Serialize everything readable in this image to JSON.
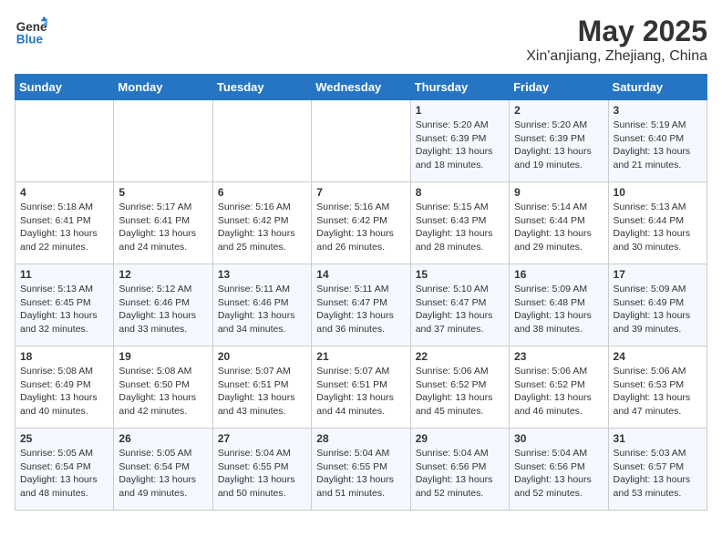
{
  "header": {
    "logo_line1": "General",
    "logo_line2": "Blue",
    "month_year": "May 2025",
    "location": "Xin'anjiang, Zhejiang, China"
  },
  "days_of_week": [
    "Sunday",
    "Monday",
    "Tuesday",
    "Wednesday",
    "Thursday",
    "Friday",
    "Saturday"
  ],
  "weeks": [
    [
      {
        "day": "",
        "info": ""
      },
      {
        "day": "",
        "info": ""
      },
      {
        "day": "",
        "info": ""
      },
      {
        "day": "",
        "info": ""
      },
      {
        "day": "1",
        "info": "Sunrise: 5:20 AM\nSunset: 6:39 PM\nDaylight: 13 hours\nand 18 minutes."
      },
      {
        "day": "2",
        "info": "Sunrise: 5:20 AM\nSunset: 6:39 PM\nDaylight: 13 hours\nand 19 minutes."
      },
      {
        "day": "3",
        "info": "Sunrise: 5:19 AM\nSunset: 6:40 PM\nDaylight: 13 hours\nand 21 minutes."
      }
    ],
    [
      {
        "day": "4",
        "info": "Sunrise: 5:18 AM\nSunset: 6:41 PM\nDaylight: 13 hours\nand 22 minutes."
      },
      {
        "day": "5",
        "info": "Sunrise: 5:17 AM\nSunset: 6:41 PM\nDaylight: 13 hours\nand 24 minutes."
      },
      {
        "day": "6",
        "info": "Sunrise: 5:16 AM\nSunset: 6:42 PM\nDaylight: 13 hours\nand 25 minutes."
      },
      {
        "day": "7",
        "info": "Sunrise: 5:16 AM\nSunset: 6:42 PM\nDaylight: 13 hours\nand 26 minutes."
      },
      {
        "day": "8",
        "info": "Sunrise: 5:15 AM\nSunset: 6:43 PM\nDaylight: 13 hours\nand 28 minutes."
      },
      {
        "day": "9",
        "info": "Sunrise: 5:14 AM\nSunset: 6:44 PM\nDaylight: 13 hours\nand 29 minutes."
      },
      {
        "day": "10",
        "info": "Sunrise: 5:13 AM\nSunset: 6:44 PM\nDaylight: 13 hours\nand 30 minutes."
      }
    ],
    [
      {
        "day": "11",
        "info": "Sunrise: 5:13 AM\nSunset: 6:45 PM\nDaylight: 13 hours\nand 32 minutes."
      },
      {
        "day": "12",
        "info": "Sunrise: 5:12 AM\nSunset: 6:46 PM\nDaylight: 13 hours\nand 33 minutes."
      },
      {
        "day": "13",
        "info": "Sunrise: 5:11 AM\nSunset: 6:46 PM\nDaylight: 13 hours\nand 34 minutes."
      },
      {
        "day": "14",
        "info": "Sunrise: 5:11 AM\nSunset: 6:47 PM\nDaylight: 13 hours\nand 36 minutes."
      },
      {
        "day": "15",
        "info": "Sunrise: 5:10 AM\nSunset: 6:47 PM\nDaylight: 13 hours\nand 37 minutes."
      },
      {
        "day": "16",
        "info": "Sunrise: 5:09 AM\nSunset: 6:48 PM\nDaylight: 13 hours\nand 38 minutes."
      },
      {
        "day": "17",
        "info": "Sunrise: 5:09 AM\nSunset: 6:49 PM\nDaylight: 13 hours\nand 39 minutes."
      }
    ],
    [
      {
        "day": "18",
        "info": "Sunrise: 5:08 AM\nSunset: 6:49 PM\nDaylight: 13 hours\nand 40 minutes."
      },
      {
        "day": "19",
        "info": "Sunrise: 5:08 AM\nSunset: 6:50 PM\nDaylight: 13 hours\nand 42 minutes."
      },
      {
        "day": "20",
        "info": "Sunrise: 5:07 AM\nSunset: 6:51 PM\nDaylight: 13 hours\nand 43 minutes."
      },
      {
        "day": "21",
        "info": "Sunrise: 5:07 AM\nSunset: 6:51 PM\nDaylight: 13 hours\nand 44 minutes."
      },
      {
        "day": "22",
        "info": "Sunrise: 5:06 AM\nSunset: 6:52 PM\nDaylight: 13 hours\nand 45 minutes."
      },
      {
        "day": "23",
        "info": "Sunrise: 5:06 AM\nSunset: 6:52 PM\nDaylight: 13 hours\nand 46 minutes."
      },
      {
        "day": "24",
        "info": "Sunrise: 5:06 AM\nSunset: 6:53 PM\nDaylight: 13 hours\nand 47 minutes."
      }
    ],
    [
      {
        "day": "25",
        "info": "Sunrise: 5:05 AM\nSunset: 6:54 PM\nDaylight: 13 hours\nand 48 minutes."
      },
      {
        "day": "26",
        "info": "Sunrise: 5:05 AM\nSunset: 6:54 PM\nDaylight: 13 hours\nand 49 minutes."
      },
      {
        "day": "27",
        "info": "Sunrise: 5:04 AM\nSunset: 6:55 PM\nDaylight: 13 hours\nand 50 minutes."
      },
      {
        "day": "28",
        "info": "Sunrise: 5:04 AM\nSunset: 6:55 PM\nDaylight: 13 hours\nand 51 minutes."
      },
      {
        "day": "29",
        "info": "Sunrise: 5:04 AM\nSunset: 6:56 PM\nDaylight: 13 hours\nand 52 minutes."
      },
      {
        "day": "30",
        "info": "Sunrise: 5:04 AM\nSunset: 6:56 PM\nDaylight: 13 hours\nand 52 minutes."
      },
      {
        "day": "31",
        "info": "Sunrise: 5:03 AM\nSunset: 6:57 PM\nDaylight: 13 hours\nand 53 minutes."
      }
    ]
  ]
}
